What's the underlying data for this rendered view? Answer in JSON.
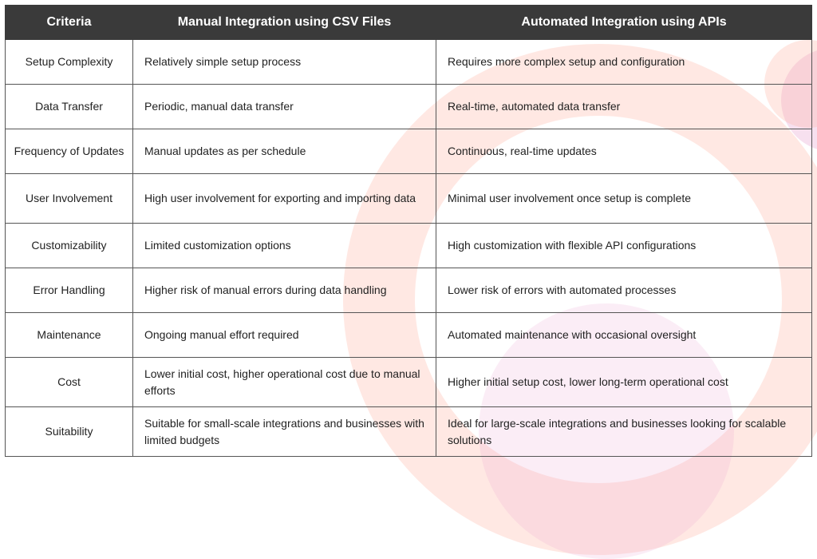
{
  "table": {
    "headers": {
      "criteria": "Criteria",
      "manual": "Manual Integration using CSV Files",
      "automated": "Automated Integration using APIs"
    },
    "rows": [
      {
        "criteria": "Setup Complexity",
        "manual": "Relatively simple setup process",
        "automated": "Requires more complex setup and configuration"
      },
      {
        "criteria": "Data Transfer",
        "manual": "Periodic, manual data transfer",
        "automated": "Real-time, automated data transfer"
      },
      {
        "criteria": "Frequency of Updates",
        "manual": "Manual updates as per schedule",
        "automated": "Continuous, real-time updates"
      },
      {
        "criteria": "User Involvement",
        "manual": "High user involvement for exporting and importing data",
        "automated": "Minimal user involvement once setup is complete"
      },
      {
        "criteria": "Customizability",
        "manual": "Limited customization options",
        "automated": "High customization with flexible API configurations"
      },
      {
        "criteria": "Error Handling",
        "manual": "Higher risk of manual errors during data handling",
        "automated": "Lower risk of errors with automated processes"
      },
      {
        "criteria": "Maintenance",
        "manual": "Ongoing manual effort required",
        "automated": "Automated maintenance with occasional oversight"
      },
      {
        "criteria": "Cost",
        "manual": "Lower initial cost, higher operational cost due to manual efforts",
        "automated": "Higher initial setup cost, lower long-term operational cost"
      },
      {
        "criteria": "Suitability",
        "manual": "Suitable for small-scale integrations and businesses with limited budgets",
        "automated": "Ideal for large-scale integrations and businesses looking for scalable solutions"
      }
    ]
  }
}
